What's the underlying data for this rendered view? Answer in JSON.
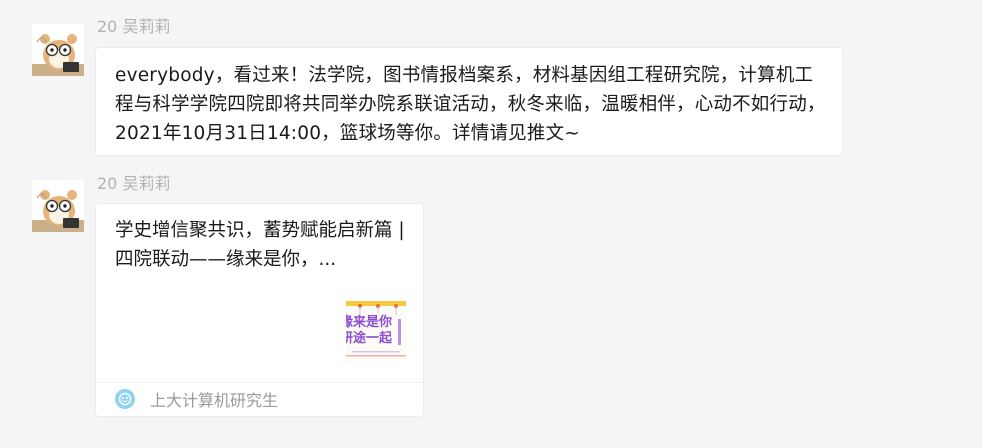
{
  "messages": [
    {
      "sender": "20 吴莉莉",
      "text": "everybody，看过来！法学院，图书情报档案系，材料基因组工程研究院，计算机工程与科学学院四院即将共同举办院系联谊活动，秋冬来临，温暖相伴，心动不如行动，2021年10月31日14:00，篮球场等你。详情请见推文~"
    },
    {
      "sender": "20 吴莉莉",
      "card": {
        "title": "学史增信聚共识，蓄势赋能启新篇 | 四院联动——缘来是你，...",
        "thumb_line1": "缘来是你",
        "thumb_line2": "研途一起",
        "source": "上大计算机研究生",
        "source_icon": "wechat-official-account-icon"
      }
    }
  ],
  "colors": {
    "background": "#f5f5f5",
    "bubble": "#ffffff",
    "sender_name": "#b2b2b2",
    "thumb_accent": "#f5c842",
    "thumb_text": "#8a4fd0"
  }
}
